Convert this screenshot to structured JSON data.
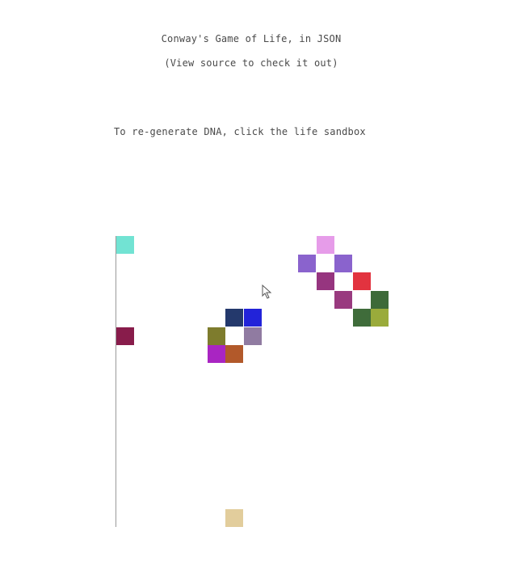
{
  "header": {
    "title": "Conway's Game of Life, in JSON",
    "subtitle": "(View source to check it out)",
    "instruction": "To re-generate DNA, click the life sandbox"
  },
  "board": {
    "cols": 16,
    "rows": 16,
    "live_cells": [
      {
        "col": 0,
        "row": 0,
        "color": "#72e3d3"
      },
      {
        "col": 0,
        "row": 5,
        "color": "#881c4b"
      },
      {
        "col": 11,
        "row": 0,
        "color": "#e69ce9"
      },
      {
        "col": 10,
        "row": 1,
        "color": "#8a63cd"
      },
      {
        "col": 12,
        "row": 1,
        "color": "#8a63cd"
      },
      {
        "col": 11,
        "row": 2,
        "color": "#96357f"
      },
      {
        "col": 13,
        "row": 2,
        "color": "#e2333f"
      },
      {
        "col": 12,
        "row": 3,
        "color": "#993a7f"
      },
      {
        "col": 14,
        "row": 3,
        "color": "#3d6a38"
      },
      {
        "col": 13,
        "row": 4,
        "color": "#3f6c3a"
      },
      {
        "col": 14,
        "row": 4,
        "color": "#9aab3b"
      },
      {
        "col": 6,
        "row": 4,
        "color": "#24396c"
      },
      {
        "col": 7,
        "row": 4,
        "color": "#2223d9"
      },
      {
        "col": 5,
        "row": 5,
        "color": "#7e7c2d"
      },
      {
        "col": 7,
        "row": 5,
        "color": "#907ba1"
      },
      {
        "col": 5,
        "row": 6,
        "color": "#a925c2"
      },
      {
        "col": 6,
        "row": 6,
        "color": "#b2592a"
      },
      {
        "col": 6,
        "row": 15,
        "color": "#e2cd9c"
      }
    ]
  }
}
